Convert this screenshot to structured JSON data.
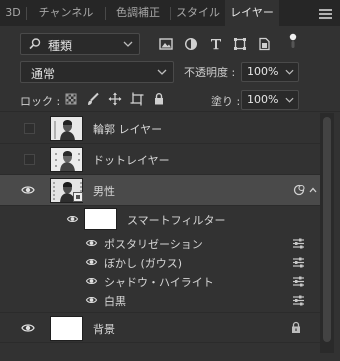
{
  "tabs": [
    {
      "label": "3D",
      "active": false
    },
    {
      "label": "チャンネル",
      "active": false
    },
    {
      "label": "色調補正",
      "active": false
    },
    {
      "label": "スタイル",
      "active": false
    },
    {
      "label": "レイヤー",
      "active": true
    }
  ],
  "filter": {
    "kind_label": "種類",
    "icons": [
      "image-filter-icon",
      "adjustment-filter-icon",
      "type-filter-icon",
      "shape-filter-icon",
      "smart-object-filter-icon"
    ]
  },
  "blend": {
    "mode": "通常",
    "opacity_label": "不透明度 :",
    "opacity_value": "100%",
    "fill_label": "塗り :",
    "fill_value": "100%"
  },
  "lock": {
    "label": "ロック :",
    "icons": [
      "lock-transparent-icon",
      "lock-paint-icon",
      "lock-position-icon",
      "lock-artboard-icon",
      "lock-all-icon"
    ]
  },
  "layers": [
    {
      "name": "輪郭 レイヤー",
      "visible": false,
      "selected": false
    },
    {
      "name": "ドットレイヤー",
      "visible": false,
      "selected": false
    },
    {
      "name": "男性",
      "visible": true,
      "selected": true
    },
    {
      "name": "背景",
      "visible": true,
      "selected": false,
      "locked": true
    }
  ],
  "smart_filter": {
    "label": "スマートフィルター",
    "filters": [
      "ポスタリゼーション",
      "ぼかし (ガウス)",
      "シャドウ・ハイライト",
      "白黒"
    ]
  },
  "colors": {
    "panel_bg": "#323232",
    "tab_bg": "#262626",
    "selected_row": "#4a4a4a",
    "text": "#d6d6d6"
  }
}
